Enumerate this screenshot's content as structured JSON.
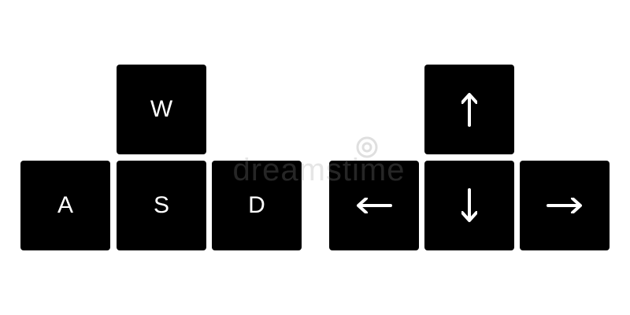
{
  "wasd_cluster": {
    "up_key": {
      "label": "W"
    },
    "left_key": {
      "label": "A"
    },
    "down_key": {
      "label": "S"
    },
    "right_key": {
      "label": "D"
    }
  },
  "arrow_cluster": {
    "up_key": {
      "icon": "arrow-up-icon"
    },
    "left_key": {
      "icon": "arrow-left-icon"
    },
    "down_key": {
      "icon": "arrow-down-icon"
    },
    "right_key": {
      "icon": "arrow-right-icon"
    }
  },
  "watermark": {
    "text": "dreamstime",
    "icon": "dreamstime-logo-icon"
  },
  "colors": {
    "key_background": "#000000",
    "key_glyph": "#ffffff",
    "page_background": "#ffffff"
  }
}
